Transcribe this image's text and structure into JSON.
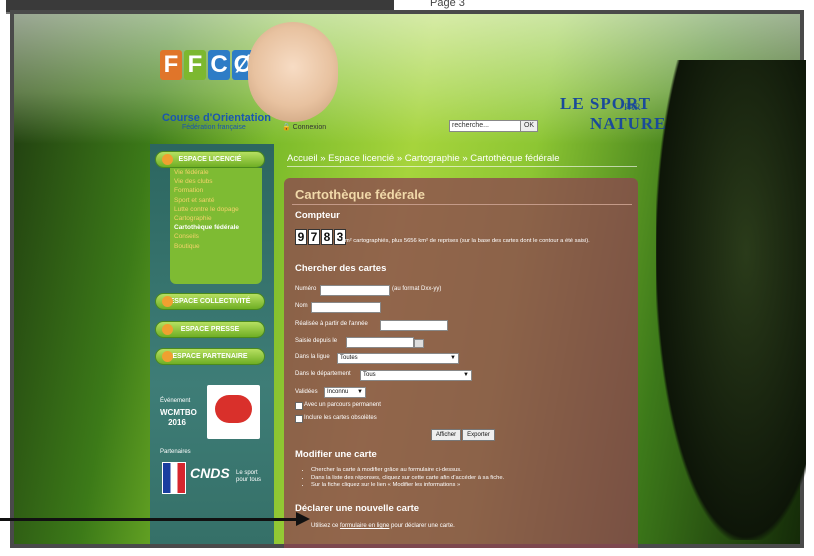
{
  "page_label": "Page 3",
  "header": {
    "logo_text": "FFCØ",
    "logo_line1": "Course d'Orientation",
    "logo_line2": "Fédération française",
    "connexion": "Connexion",
    "search_placeholder": "recherche...",
    "search_button": "OK",
    "slogan_le_sport": "LE SPORT",
    "slogan_par": "PAR",
    "slogan_nature": "NATURE"
  },
  "sidebar": {
    "espace_licencie": "ESPACE LICENCIÉ",
    "menu": [
      "Vie fédérale",
      "Vie des clubs",
      "Formation",
      "Sport et santé",
      "Lutte contre le dopage",
      "Cartographie",
      "Cartothèque fédérale",
      "Conseils",
      "Boutique"
    ],
    "espace_collectivite": "ESPACE COLLECTIVITÉ",
    "espace_presse": "ESPACE PRESSE",
    "espace_partenaire": "ESPACE PARTENAIRE",
    "event_label": "Événement",
    "event_title": "WCMTBO 2016",
    "partners_label": "Partenaires",
    "cnds": "CNDS",
    "cnds_sub": "Le sport pour tous"
  },
  "breadcrumb": "Accueil » Espace licencié » Cartographie » Cartothèque fédérale",
  "main": {
    "title": "Cartothèque fédérale",
    "compteur_heading": "Compteur",
    "digits": [
      "9",
      "7",
      "8",
      "3"
    ],
    "counter_text": "km² cartographiés, plus 5656 km² de reprises (sur la base des cartes dont le contour a été saisi).",
    "search_heading": "Chercher des cartes",
    "form": {
      "numero_label": "Numéro",
      "numero_hint": "(au format Dxx-yy)",
      "nom_label": "Nom",
      "annee_label": "Réalisée à partir de l'année",
      "saisie_label": "Saisie depuis le",
      "ligue_label": "Dans la ligue",
      "ligue_value": "Toutes",
      "dept_label": "Dans le département",
      "dept_value": "Tous",
      "validees_label": "Validées",
      "validees_value": "Inconnu",
      "parcours_label": "Avec un parcours permanent",
      "obsoletes_label": "Inclure les cartes obsolètes",
      "afficher_button": "Afficher",
      "exporter_button": "Exporter"
    },
    "modify_heading": "Modifier une carte",
    "modify_items": [
      "Chercher la carte à modifier grâce au formulaire ci-dessus.",
      "Dans la liste des réponses, cliquez sur cette carte afin d'accéder à sa fiche.",
      "Sur la fiche cliquez sur le lien « Modifier les informations »"
    ],
    "declare_heading": "Déclarer une nouvelle carte",
    "declare_prefix": "Utilisez ce ",
    "declare_link": "formulaire en ligne",
    "declare_suffix": " pour déclarer une carte."
  }
}
